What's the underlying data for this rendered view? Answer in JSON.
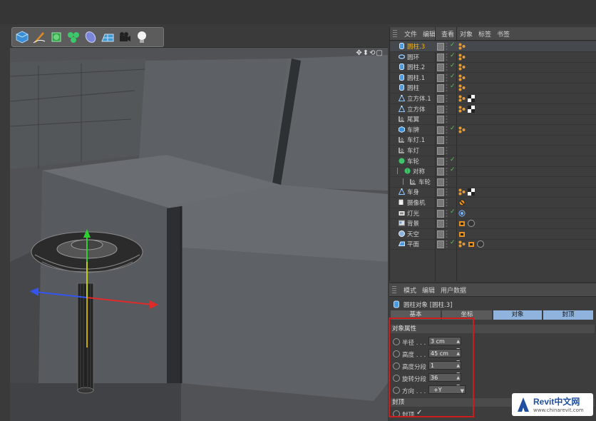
{
  "toolbar": {
    "tools": [
      "cube-icon",
      "pen-icon",
      "subdivision-icon",
      "cloner-icon",
      "deformer-icon",
      "floor-icon",
      "camera-icon",
      "light-icon"
    ]
  },
  "object_manager": {
    "menu": [
      "文件",
      "编辑",
      "查看",
      "对象",
      "标签",
      "书签"
    ],
    "objects": [
      {
        "label": "圆柱.3",
        "indent": 0,
        "icon": "cylinder-icon",
        "selected": true,
        "check": true,
        "tags": [
          "material-tag"
        ]
      },
      {
        "label": "圆环",
        "indent": 0,
        "icon": "torus-icon",
        "check": true,
        "tags": [
          "material-tag"
        ]
      },
      {
        "label": "圆柱.2",
        "indent": 0,
        "icon": "cylinder-icon",
        "check": true,
        "tags": [
          "material-tag"
        ]
      },
      {
        "label": "圆柱.1",
        "indent": 0,
        "icon": "cylinder-icon",
        "check": true,
        "tags": [
          "material-tag"
        ]
      },
      {
        "label": "圆柱",
        "indent": 0,
        "icon": "cylinder-icon",
        "check": true,
        "tags": [
          "material-tag"
        ]
      },
      {
        "label": "立方体.1",
        "indent": 0,
        "icon": "polygon-icon",
        "check": false,
        "tags": [
          "material-tag",
          "checker-tag"
        ]
      },
      {
        "label": "立方体",
        "indent": 0,
        "icon": "polygon-icon",
        "check": false,
        "tags": [
          "material-tag",
          "checker-tag"
        ]
      },
      {
        "label": "尾翼",
        "indent": 0,
        "icon": "null-icon",
        "check": false,
        "tags": []
      },
      {
        "label": "车牌",
        "indent": 0,
        "icon": "cube-icon",
        "check": true,
        "tags": [
          "material-tag"
        ]
      },
      {
        "label": "车灯.1",
        "indent": 0,
        "icon": "null-icon",
        "check": false,
        "tags": []
      },
      {
        "label": "车灯",
        "indent": 0,
        "icon": "null-icon",
        "check": false,
        "tags": []
      },
      {
        "label": "车轮",
        "indent": 0,
        "icon": "sphere-icon",
        "check": true,
        "tags": []
      },
      {
        "label": "对称",
        "indent": 1,
        "icon": "symmetry-icon",
        "check": true,
        "tags": []
      },
      {
        "label": "车轮",
        "indent": 2,
        "icon": "null-icon",
        "check": false,
        "tags": []
      },
      {
        "label": "车身",
        "indent": 0,
        "icon": "polygon-icon",
        "check": false,
        "tags": [
          "material-tag",
          "checker-tag"
        ]
      },
      {
        "label": "摄像机",
        "indent": 0,
        "icon": "camera-icon",
        "check": false,
        "tags": [
          "no-tag"
        ]
      },
      {
        "label": "灯光",
        "indent": 0,
        "icon": "light-icon",
        "check": true,
        "tags": [
          "target-tag"
        ]
      },
      {
        "label": "背景",
        "indent": 0,
        "icon": "background-icon",
        "check": false,
        "tags": [
          "compositing-tag",
          "sphere-material-tag"
        ]
      },
      {
        "label": "天空",
        "indent": 0,
        "icon": "sky-icon",
        "check": false,
        "tags": [
          "compositing-tag"
        ]
      },
      {
        "label": "平面",
        "indent": 0,
        "icon": "plane-icon",
        "check": true,
        "tags": [
          "material-tag",
          "compositing-tag",
          "sphere-material-tag"
        ]
      }
    ]
  },
  "attribute_manager": {
    "menu": [
      "模式",
      "编辑",
      "用户数据"
    ],
    "title": "圆柱对象 [圆柱.3]",
    "tabs": [
      "基本",
      "坐标",
      "对象",
      "封顶"
    ],
    "active_tab": "对象",
    "section_object": "对象属性",
    "properties": [
      {
        "label": "半径 . . .",
        "value": "3 cm",
        "kind": "number"
      },
      {
        "label": "高度 . . .",
        "value": "45 cm",
        "kind": "number"
      },
      {
        "label": "高度分段",
        "value": "1",
        "kind": "number"
      },
      {
        "label": "旋转分段",
        "value": "36",
        "kind": "number"
      },
      {
        "label": "方向 . . .",
        "value": "+Y",
        "kind": "dropdown"
      }
    ],
    "section_caps": "封顶",
    "caps": {
      "label": "封顶",
      "checked": "✓"
    }
  },
  "watermark": {
    "brand": "Revit中文网",
    "url": "www.chinarevit.com"
  },
  "viewport": {
    "nav": "✥⬍⟲▢"
  }
}
